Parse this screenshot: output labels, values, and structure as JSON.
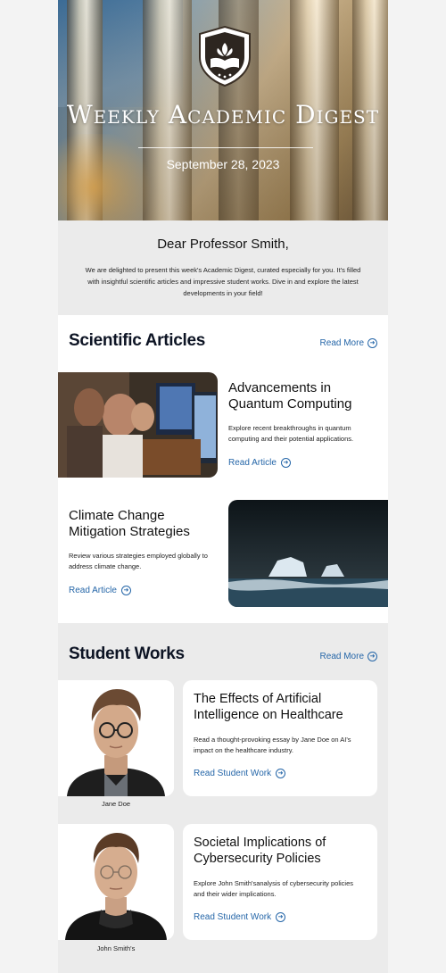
{
  "hero": {
    "title": "Weekly Academic Digest",
    "date": "September 28, 2023"
  },
  "greeting": {
    "salutation": "Dear Professor Smith,",
    "message": "We are delighted to present this week's Academic Digest, curated especially for you. It's filled with insightful scientific articles and impressive student works. Dive in and explore the latest developments in your field!"
  },
  "articles": {
    "heading": "Scientific Articles",
    "read_more": "Read More",
    "items": [
      {
        "title": "Advancements in Quantum Computing",
        "description": "Explore recent breakthroughs in quantum computing and their potential applications.",
        "link": "Read Article"
      },
      {
        "title": "Climate Change Mitigation Strategies",
        "description": "Review various strategies employed globally to address climate change.",
        "link": "Read Article"
      }
    ]
  },
  "students": {
    "heading": "Student Works",
    "read_more": "Read More",
    "items": [
      {
        "title": "The Effects of Artificial Intelligence on Healthcare",
        "description": "Read a thought-provoking essay by Jane Doe on AI's impact on the healthcare industry.",
        "link": "Read Student Work",
        "caption": "Jane Doe"
      },
      {
        "title": "Societal Implications of Cybersecurity Policies",
        "description": "Explore John Smith'sanalysis of cybersecurity policies and their wider implications.",
        "link": "Read Student Work",
        "caption": "John Smith's"
      }
    ]
  },
  "icons": {
    "emblem": "shield-book-icon",
    "arrow": "arrow-right-circle-icon"
  },
  "colors": {
    "accent": "#2566a8",
    "heading": "#0d1424",
    "section_bg": "#ebebeb"
  }
}
